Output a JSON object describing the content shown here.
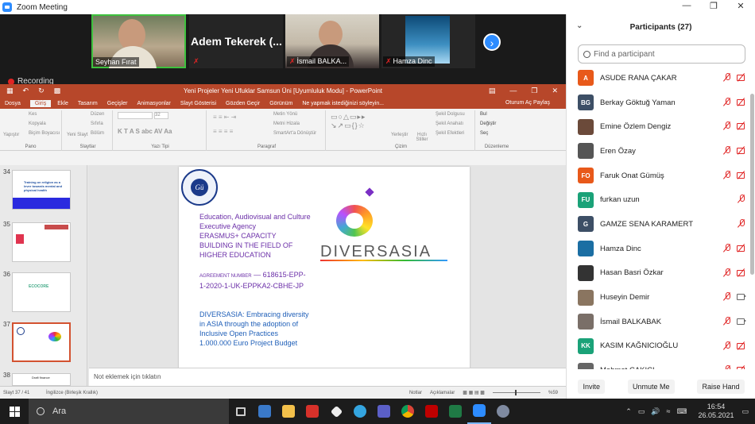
{
  "window": {
    "title": "Zoom Meeting"
  },
  "videos": [
    {
      "name": "Seyhan Fırat"
    },
    {
      "name": "Adem Tekerek (...",
      "big": "Adem Tekerek (..."
    },
    {
      "name": "İsmail BALKA..."
    },
    {
      "name": "Hamza Dinc"
    }
  ],
  "recording": "Recording",
  "ppt": {
    "title": "Yeni Projeler Yeni Ufuklar Samsun Üni [Uyumluluk Modu] - PowerPoint",
    "tabs": [
      "Dosya",
      "Giriş",
      "Ekle",
      "Tasarım",
      "Geçişler",
      "Animasyonlar",
      "Slayt Gösterisi",
      "Gözden Geçir",
      "Görünüm",
      "Ne yapmak istediğinizi söyleyin..."
    ],
    "tab_right": "Oturum Aç   Paylaş",
    "groups": [
      "Pano",
      "Slaytlar",
      "Yazı Tipi",
      "Paragraf",
      "Çizim",
      "Düzenleme"
    ],
    "ribbon": {
      "paste": "Yapıştır",
      "cut": "Kes",
      "copy": "Kopyala",
      "format_painter": "Biçim Boyacısı",
      "new_slide": "Yeni Slayt",
      "layout": "Düzen",
      "reset": "Sıfırla",
      "section": "Bölüm",
      "font_size": "32",
      "font_buttons": "K  T  A  S  abc  AV  Aa",
      "text_direction": "Metin Yönü",
      "align_text": "Metni Hizala",
      "smartart": "SmartArt'a Dönüştür",
      "arrange": "Yerleştir",
      "quick_styles": "Hızlı Stiller",
      "shape_fill": "Şekil Dolgusu",
      "shape_outline": "Şekil Anahatı",
      "shape_effects": "Şekil Efektleri",
      "find": "Bul",
      "replace": "Değiştir",
      "select": "Seç"
    },
    "slide_numbers": [
      "34",
      "35",
      "36",
      "37",
      "38"
    ],
    "slide_thumb_text": [
      "Training on religion as a lever towards mental and physical health",
      "",
      "ECOCORE",
      "",
      "Draft finance"
    ],
    "slide": {
      "logo_text": "GAZİ ÜNİVERSİTESİ 1926",
      "brand": "DIVERSASIA",
      "line1": "Education, Audiovisual and Culture Executive Agency",
      "line2": "ERASMUS+ CAPACITY BUILDING IN THE FIELD OF HIGHER EDUCATION",
      "agreement_label": "AGREEMENT NUMBER",
      "agreement_value": "— 618615-EPP-1-2020-1-UK-EPPKA2-CBHE-JP",
      "desc": "DIVERSASIA: Embracing diversity in ASIA through the adoption of Inclusive Open Practices",
      "budget": "1.000.000 Euro Project Budget"
    },
    "notes_placeholder": "Not eklemek için tıklatın",
    "status_left": "Slayt 37 / 41",
    "status_lang": "İngilizce (Birleşik Krallık)",
    "status_notes": "Notlar",
    "status_comments": "Açıklamalar",
    "zoom_level": "%59"
  },
  "participants": {
    "header": "Participants (27)",
    "search_placeholder": "Find a participant",
    "list": [
      {
        "initials": "A",
        "name": "ASUDE RANA ÇAKAR",
        "color": "#e8591a",
        "mic": "off",
        "video": "off"
      },
      {
        "initials": "BG",
        "name": "Berkay Göktuğ Yaman",
        "color": "#3d4f66",
        "mic": "off",
        "video": "off"
      },
      {
        "initials": "",
        "name": "Emine Özlem Dengiz",
        "color": "#6b4a3a",
        "mic": "off",
        "video": "off"
      },
      {
        "initials": "",
        "name": "Eren Özay",
        "color": "#555555",
        "mic": "off",
        "video": "off"
      },
      {
        "initials": "FO",
        "name": "Faruk Onat Gümüş",
        "color": "#e8591a",
        "mic": "off",
        "video": "off"
      },
      {
        "initials": "FU",
        "name": "furkan uzun",
        "color": "#1aa278",
        "mic": "off",
        "video": "none"
      },
      {
        "initials": "G",
        "name": "GAMZE SENA KARAMERT",
        "color": "#3d4f66",
        "mic": "off",
        "video": "none"
      },
      {
        "initials": "",
        "name": "Hamza Dinc",
        "color": "#1b6ea3",
        "mic": "off",
        "video": "off"
      },
      {
        "initials": "",
        "name": "Hasan Basri Özkar",
        "color": "#333333",
        "mic": "off",
        "video": "off"
      },
      {
        "initials": "",
        "name": "Huseyin Demir",
        "color": "#8a7560",
        "mic": "off",
        "video": "on"
      },
      {
        "initials": "",
        "name": "İsmail BALKABAK",
        "color": "#7a6f68",
        "mic": "off",
        "video": "on"
      },
      {
        "initials": "KK",
        "name": "KASIM KAĞNICIOĞLU",
        "color": "#1aa278",
        "mic": "off",
        "video": "off"
      },
      {
        "initials": "",
        "name": "Mehmet ÇAKICI",
        "color": "#666666",
        "mic": "off",
        "video": "off"
      }
    ],
    "buttons": [
      "Invite",
      "Unmute Me",
      "Raise Hand"
    ]
  },
  "taskbar": {
    "search": "Ara",
    "time": "16:54",
    "date": "26.05.2021"
  }
}
